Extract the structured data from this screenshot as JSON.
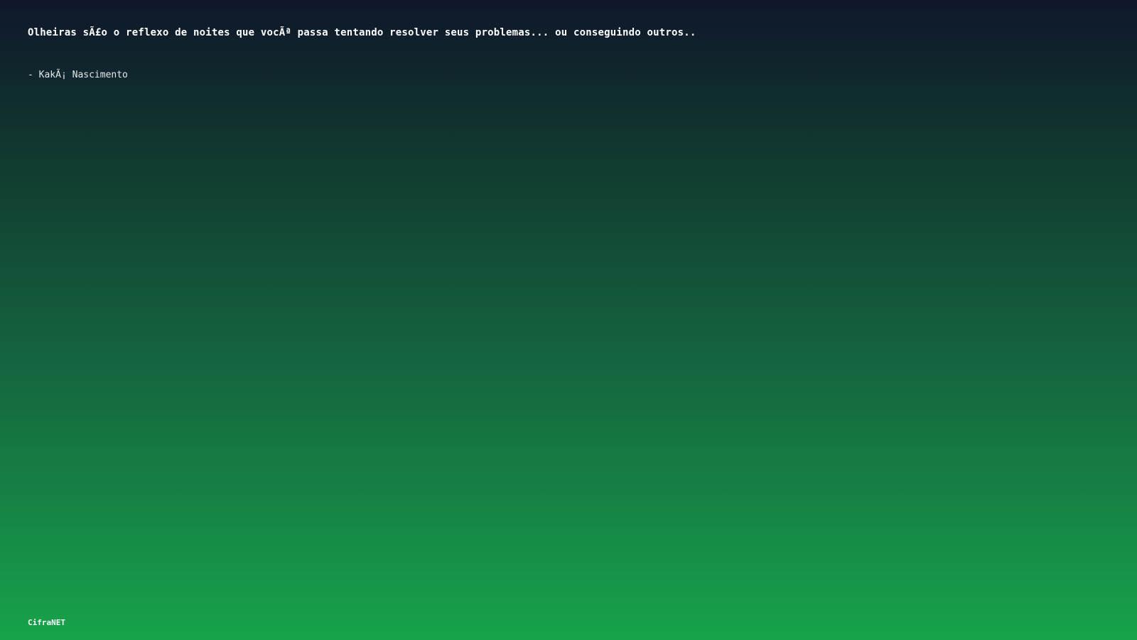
{
  "quote": {
    "text": "Olheiras sÃ£o o reflexo de noites que vocÃª passa tentando resolver seus problemas... ou conseguindo outros..",
    "author": "- KakÃ¡ Nascimento"
  },
  "footer": {
    "brand": "CifraNET"
  },
  "colors": {
    "gradient_top": "#0f172a",
    "gradient_bottom": "#16a34a",
    "text": "#ffffff"
  }
}
